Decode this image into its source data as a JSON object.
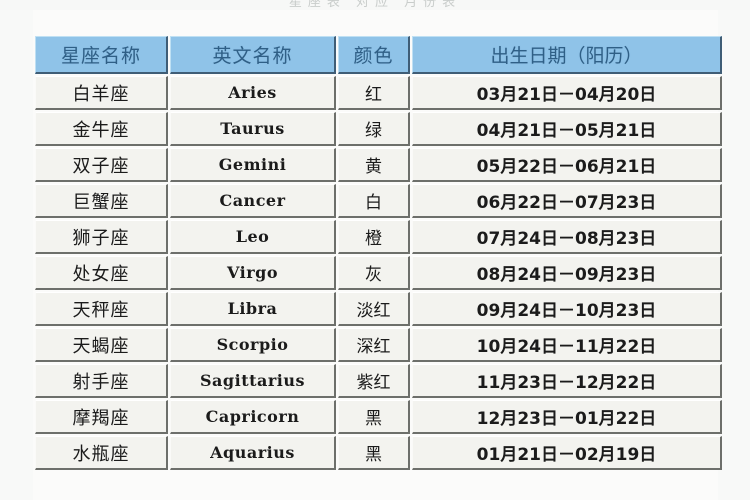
{
  "page": {
    "top_ghost_text": "星座表 对应 月份表",
    "background_color": "#fbfbfa"
  },
  "table": {
    "accent_header_bg": "#8fc3e8",
    "header_text_color": "#2f5f86",
    "cell_bg": "#f3f3ef",
    "cell_text_color": "#1b1b1b",
    "columns": [
      {
        "key": "name",
        "label": "星座名称"
      },
      {
        "key": "eng",
        "label": "英文名称"
      },
      {
        "key": "color",
        "label": "颜色"
      },
      {
        "key": "date",
        "label": "出生日期（阳历）"
      }
    ],
    "rows": [
      {
        "name": "白羊座",
        "eng": "Aries",
        "color": "红",
        "date": "03月21日－04月20日"
      },
      {
        "name": "金牛座",
        "eng": "Taurus",
        "color": "绿",
        "date": "04月21日－05月21日"
      },
      {
        "name": "双子座",
        "eng": "Gemini",
        "color": "黄",
        "date": "05月22日－06月21日"
      },
      {
        "name": "巨蟹座",
        "eng": "Cancer",
        "color": "白",
        "date": "06月22日－07月23日"
      },
      {
        "name": "狮子座",
        "eng": "Leo",
        "color": "橙",
        "date": "07月24日－08月23日"
      },
      {
        "name": "处女座",
        "eng": "Virgo",
        "color": "灰",
        "date": "08月24日－09月23日"
      },
      {
        "name": "天秤座",
        "eng": "Libra",
        "color": "淡红",
        "date": "09月24日－10月23日"
      },
      {
        "name": "天蝎座",
        "eng": "Scorpio",
        "color": "深红",
        "date": "10月24日－11月22日"
      },
      {
        "name": "射手座",
        "eng": "Sagittarius",
        "color": "紫红",
        "date": "11月23日－12月22日"
      },
      {
        "name": "摩羯座",
        "eng": "Capricorn",
        "color": "黑",
        "date": "12月23日－01月22日"
      },
      {
        "name": "水瓶座",
        "eng": "Aquarius",
        "color": "黑",
        "date": "01月21日－02月19日"
      }
    ]
  }
}
